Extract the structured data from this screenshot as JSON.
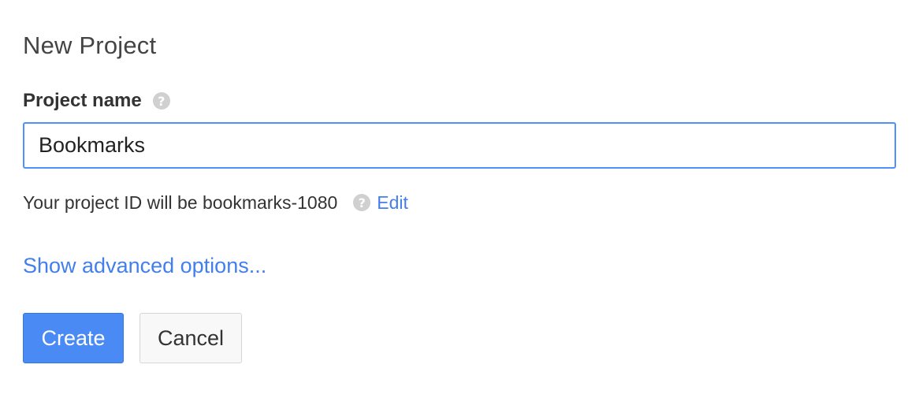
{
  "dialog": {
    "title": "New Project"
  },
  "project_name": {
    "label": "Project name",
    "value": "Bookmarks",
    "help_icon": "question-mark-icon"
  },
  "project_id": {
    "text": "Your project ID will be bookmarks-1080",
    "help_icon": "question-mark-icon",
    "edit_label": "Edit"
  },
  "advanced": {
    "label": "Show advanced options..."
  },
  "actions": {
    "create_label": "Create",
    "cancel_label": "Cancel"
  },
  "colors": {
    "accent": "#4a8af4",
    "link": "#427fed",
    "focus_border": "#4d90fe"
  }
}
